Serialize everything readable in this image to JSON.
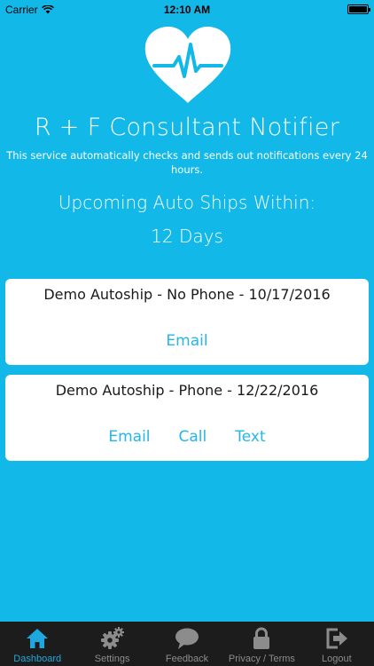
{
  "status": {
    "carrier": "Carrier",
    "time": "12:10 AM"
  },
  "app": {
    "title": "R + F Consultant Notifier",
    "description_line1": "This service automatically checks and sends out notifications every 24",
    "description_line2": "hours.",
    "upcoming_label": "Upcoming Auto Ships Within:",
    "days_label": "12 Days"
  },
  "autoships": [
    {
      "title": "Demo Autoship - No Phone - 10/17/2016",
      "actions": [
        "Email"
      ]
    },
    {
      "title": "Demo Autoship - Phone - 12/22/2016",
      "actions": [
        "Email",
        "Call",
        "Text"
      ]
    }
  ],
  "tabs": [
    {
      "label": "Dashboard",
      "icon": "home-icon"
    },
    {
      "label": "Settings",
      "icon": "gear-icon"
    },
    {
      "label": "Feedback",
      "icon": "chat-bubble-icon"
    },
    {
      "label": "Privacy / Terms",
      "icon": "lock-icon"
    },
    {
      "label": "Logout",
      "icon": "logout-icon"
    }
  ],
  "colors": {
    "background": "#12b8e8",
    "link": "#25b7e6",
    "tab_active": "#1fa8e0",
    "tab_bar": "#1c1c1c"
  }
}
